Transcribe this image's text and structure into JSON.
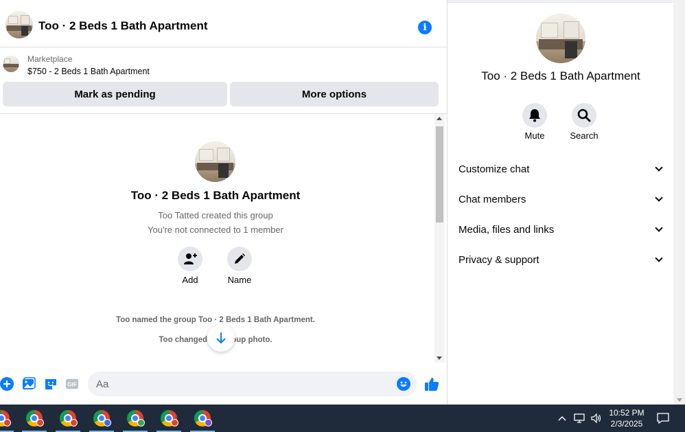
{
  "header": {
    "title": "Too · 2 Beds 1 Bath Apartment",
    "info_icon": "info-icon",
    "accent_color": "#0a7cff"
  },
  "marketplace": {
    "label": "Marketplace",
    "listing": "$750 - 2 Beds 1 Bath Apartment",
    "mark_pending_label": "Mark as pending",
    "more_options_label": "More options"
  },
  "conversation": {
    "group_title": "Too · 2 Beds 1 Bath Apartment",
    "created_text": "Too Tatted created this group",
    "connection_text": "You're not connected to 1 member",
    "add_label": "Add",
    "name_label": "Name",
    "system_messages": [
      "Too named the group Too · 2 Beds 1 Bath Apartment.",
      "Too changed the group photo."
    ]
  },
  "composer": {
    "placeholder": "Aa",
    "icons": [
      "plus-icon",
      "image-icon",
      "sticker-icon",
      "gif-icon",
      "emoji-icon",
      "like-icon"
    ],
    "gif_label": "GIF"
  },
  "details": {
    "title": "Too · 2 Beds 1 Bath Apartment",
    "mute_label": "Mute",
    "search_label": "Search",
    "sections": [
      {
        "label": "Customize chat"
      },
      {
        "label": "Chat members"
      },
      {
        "label": "Media, files and links"
      },
      {
        "label": "Privacy & support"
      }
    ]
  },
  "taskbar": {
    "apps": [
      {
        "icon": "chrome-icon",
        "profile_color": "#e0442e"
      },
      {
        "icon": "chrome-icon",
        "profile_color": "#e0442e"
      },
      {
        "icon": "chrome-icon",
        "profile_color": "#e0442e"
      },
      {
        "icon": "chrome-icon",
        "profile_color": "#3a6fd8"
      },
      {
        "icon": "chrome-icon",
        "profile_color": "#3fa34d"
      },
      {
        "icon": "chrome-icon",
        "profile_color": "#e0442e"
      },
      {
        "icon": "chrome-icon",
        "profile_color": "#7a4fd1"
      }
    ],
    "time": "10:52 PM",
    "date": "2/3/2025"
  }
}
